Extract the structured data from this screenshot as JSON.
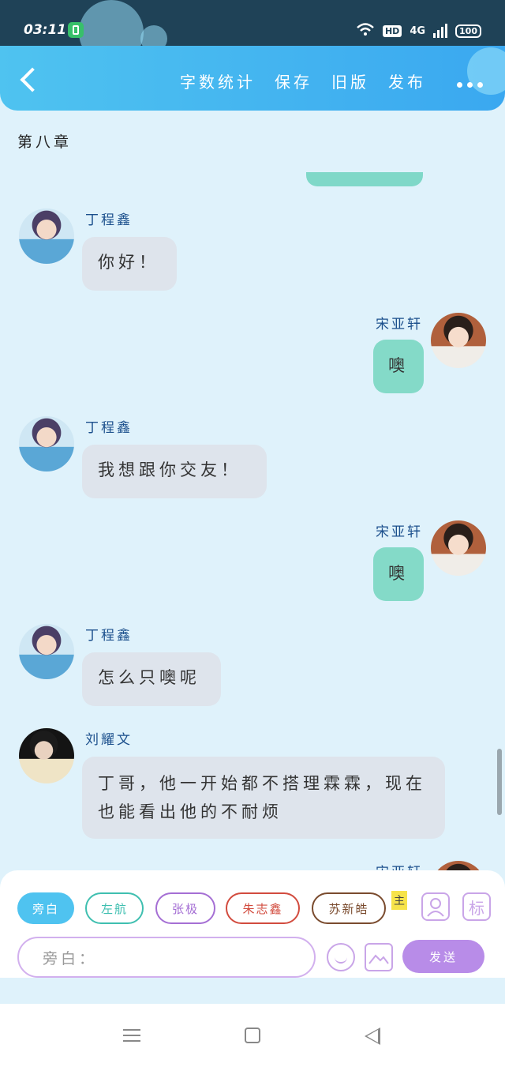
{
  "status": {
    "time": "03:11",
    "hd": "HD",
    "network": "4G",
    "battery": "100"
  },
  "header": {
    "actions": [
      "字数统计",
      "保存",
      "旧版",
      "发布"
    ]
  },
  "chapter_title": "第八章",
  "messages": [
    {
      "speaker": "丁程鑫",
      "text": "你好！"
    },
    {
      "speaker": "宋亚轩",
      "text": "噢"
    },
    {
      "speaker": "丁程鑫",
      "text": "我想跟你交友！"
    },
    {
      "speaker": "宋亚轩",
      "text": "噢"
    },
    {
      "speaker": "丁程鑫",
      "text": "怎么只噢呢"
    },
    {
      "speaker": "刘耀文",
      "text": "丁哥，他一开始都不搭理霖霖，现在也能看出他的不耐烦"
    },
    {
      "speaker": "宋亚轩"
    }
  ],
  "composer": {
    "roles": [
      {
        "label": "旁白",
        "color": "#4fc3f0"
      },
      {
        "label": "左航",
        "color": "#3fbfb0"
      },
      {
        "label": "张极",
        "color": "#a56fd4"
      },
      {
        "label": "朱志鑫",
        "color": "#d24b3e"
      },
      {
        "label": "苏新皓",
        "color": "#7a4b2e"
      }
    ],
    "main_badge": "主",
    "label_icon": "标",
    "input_placeholder": "旁白：",
    "send_label": "发送"
  }
}
